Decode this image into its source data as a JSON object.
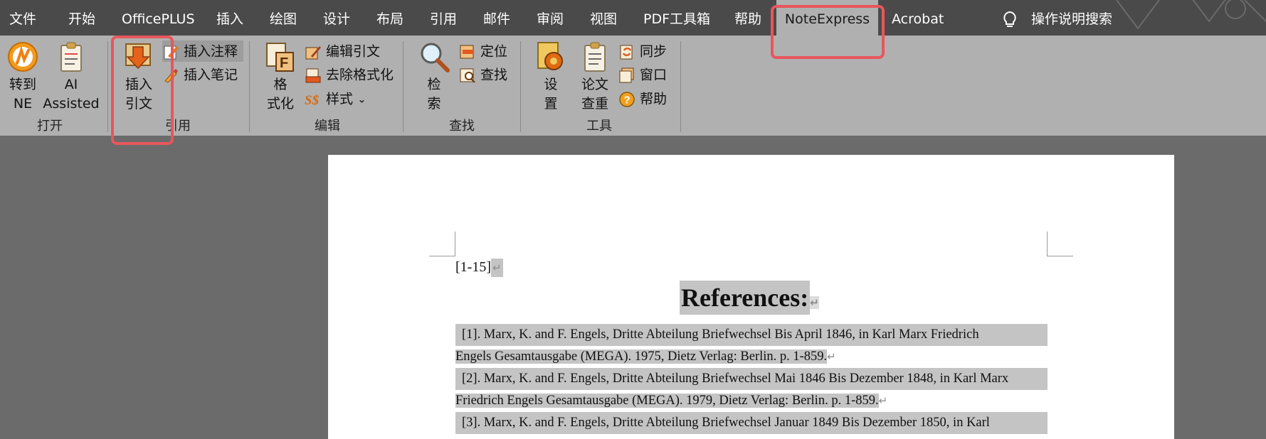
{
  "menubar": {
    "tabs": [
      "文件",
      "开始",
      "OfficePLUS",
      "插入",
      "绘图",
      "设计",
      "布局",
      "引用",
      "邮件",
      "审阅",
      "视图",
      "PDF工具箱",
      "帮助",
      "NoteExpress",
      "Acrobat"
    ],
    "active_tab": "NoteExpress",
    "tell_me": "操作说明搜索"
  },
  "ribbon": {
    "open": {
      "label": "打开",
      "to_ne_1": "转到",
      "to_ne_2": "NE",
      "ai_1": "AI",
      "ai_2": "Assisted"
    },
    "cite": {
      "label": "引用",
      "insert_1": "插入",
      "insert_2": "引文",
      "insert_note": "插入注释",
      "insert_memo": "插入笔记"
    },
    "edit": {
      "label": "编辑",
      "format_1": "格",
      "format_2": "式化",
      "edit_cite": "编辑引文",
      "remove_format": "去除格式化",
      "style": "样式",
      "style_chevron": "⌄"
    },
    "find": {
      "label": "查找",
      "search_1": "检",
      "search_2": "索",
      "locate": "定位",
      "find": "查找"
    },
    "tools": {
      "label": "工具",
      "settings_1": "设",
      "settings_2": "置",
      "check_1": "论文",
      "check_2": "查重",
      "sync": "同步",
      "window": "窗口",
      "help": "帮助"
    }
  },
  "document": {
    "citation": "[1-15]",
    "pilcrow": "↵",
    "heading": "References:",
    "references": [
      [
        "[1]. Marx, K. and F. Engels, Dritte Abteilung Briefwechsel Bis April 1846, in Karl Marx Friedrich",
        "Engels Gesamtausgabe (MEGA). 1975, Dietz Verlag: Berlin. p. 1-859."
      ],
      [
        "[2]. Marx, K. and F. Engels, Dritte Abteilung Briefwechsel Mai 1846 Bis Dezember 1848, in Karl Marx",
        "Friedrich Engels Gesamtausgabe (MEGA). 1979, Dietz Verlag: Berlin. p. 1-859."
      ],
      [
        "[3]. Marx, K. and F. Engels, Dritte Abteilung Briefwechsel Januar 1849 Bis Dezember 1850, in Karl",
        ""
      ]
    ]
  },
  "colors": {
    "highlight_box": "#e8565c",
    "ribbon_bg": "#b0b0b0",
    "menubar_bg": "#4a4a4a",
    "selection": "#c4c4c4"
  },
  "icons": [
    "noteexpress-logo-icon",
    "ai-clipboard-icon",
    "insert-citation-icon",
    "insert-note-icon",
    "insert-memo-icon",
    "format-icon",
    "edit-citation-icon",
    "remove-format-icon",
    "style-icon",
    "search-magnifier-icon",
    "locate-icon",
    "find-icon",
    "settings-gear-icon",
    "plagiarism-check-icon",
    "sync-icon",
    "window-icon",
    "help-icon",
    "lightbulb-icon"
  ]
}
